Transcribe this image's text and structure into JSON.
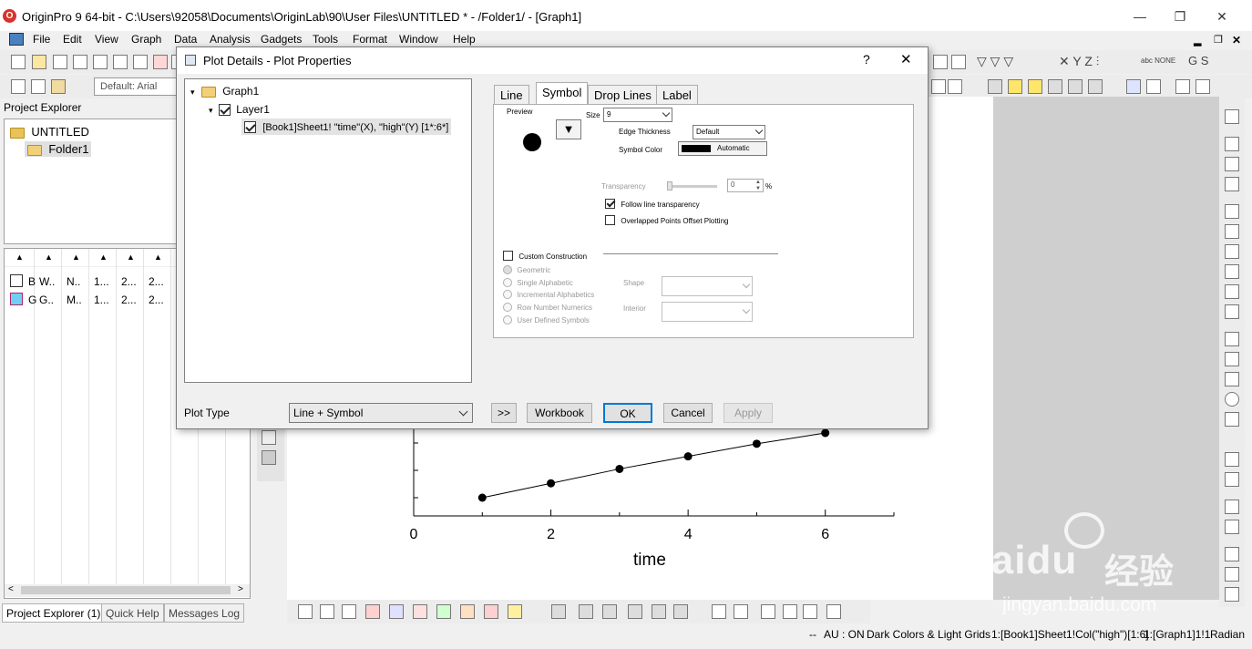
{
  "app": {
    "title": "OriginPro 9 64-bit - C:\\Users\\92058\\Documents\\OriginLab\\90\\User Files\\UNTITLED * - /Folder1/ - [Graph1]",
    "icon_label": "O"
  },
  "menu": [
    "File",
    "Edit",
    "View",
    "Graph",
    "Data",
    "Analysis",
    "Gadgets",
    "Tools",
    "Format",
    "Window",
    "Help"
  ],
  "toolbar": {
    "font_combo": "Default: Arial"
  },
  "project_explorer": {
    "title": "Project Explorer",
    "tree": [
      "UNTITLED",
      "Folder1"
    ],
    "list_rows": [
      [
        "B",
        "W..",
        "N..",
        "1...",
        "2...",
        "2..."
      ],
      [
        "G",
        "G..",
        "M..",
        "1...",
        "2...",
        "2..."
      ]
    ]
  },
  "bottom_tabs": [
    "Project Explorer (1)",
    "Quick Help",
    "Messages Log"
  ],
  "dialog": {
    "title": "Plot Details - Plot Properties",
    "help": "?",
    "close": "✕",
    "tree": [
      "Graph1",
      "Layer1",
      "[Book1]Sheet1! \"time\"(X), \"high\"(Y) [1*:6*]"
    ],
    "tabs": [
      "Line",
      "Symbol",
      "Drop Lines",
      "Label"
    ],
    "active_tab": "Symbol",
    "symbol": {
      "preview_label": "Preview",
      "size_label": "Size",
      "size_value": "9",
      "edge_thickness_label": "Edge Thickness",
      "edge_thickness_value": "Default",
      "symbol_color_label": "Symbol Color",
      "symbol_color_value": "Automatic",
      "transparency_label": "Transparency",
      "transparency_value": "0",
      "percent": "%",
      "follow_line_transparency": "Follow line transparency",
      "overlapped_points": "Overlapped Points Offset Plotting",
      "custom_construction": "Custom Construction",
      "options": [
        "Geometric",
        "Single Alphabetic",
        "Incremental Alphabetics",
        "Row Number Numerics",
        "User Defined Symbols"
      ],
      "shape_label": "Shape",
      "interior_label": "Interior"
    },
    "plot_type_label": "Plot Type",
    "plot_type_value": "Line + Symbol",
    "buttons": {
      "expand": ">>",
      "workbook": "Workbook",
      "ok": "OK",
      "cancel": "Cancel",
      "apply": "Apply"
    }
  },
  "graph": {
    "xlabel": "time",
    "x_ticks": [
      "0",
      "2",
      "4",
      "6"
    ]
  },
  "chart_data": {
    "type": "line",
    "x": [
      1,
      2,
      3,
      4,
      5,
      6
    ],
    "y": [
      1.2,
      2.0,
      2.8,
      3.5,
      4.2,
      4.8
    ],
    "xlabel": "time",
    "xlim": [
      0,
      7
    ],
    "marker": "circle"
  },
  "status": {
    "dashes": "--",
    "au": "AU : ON",
    "theme": "Dark Colors & Light Grids",
    "col": "1:[Book1]Sheet1!Col(\"high\")[1:6]",
    "graph": "1:[Graph1]1!1",
    "angle": "Radian"
  },
  "watermark": {
    "brand": "Baidu",
    "cn": "经验",
    "url": "jingyan.baidu.com"
  }
}
